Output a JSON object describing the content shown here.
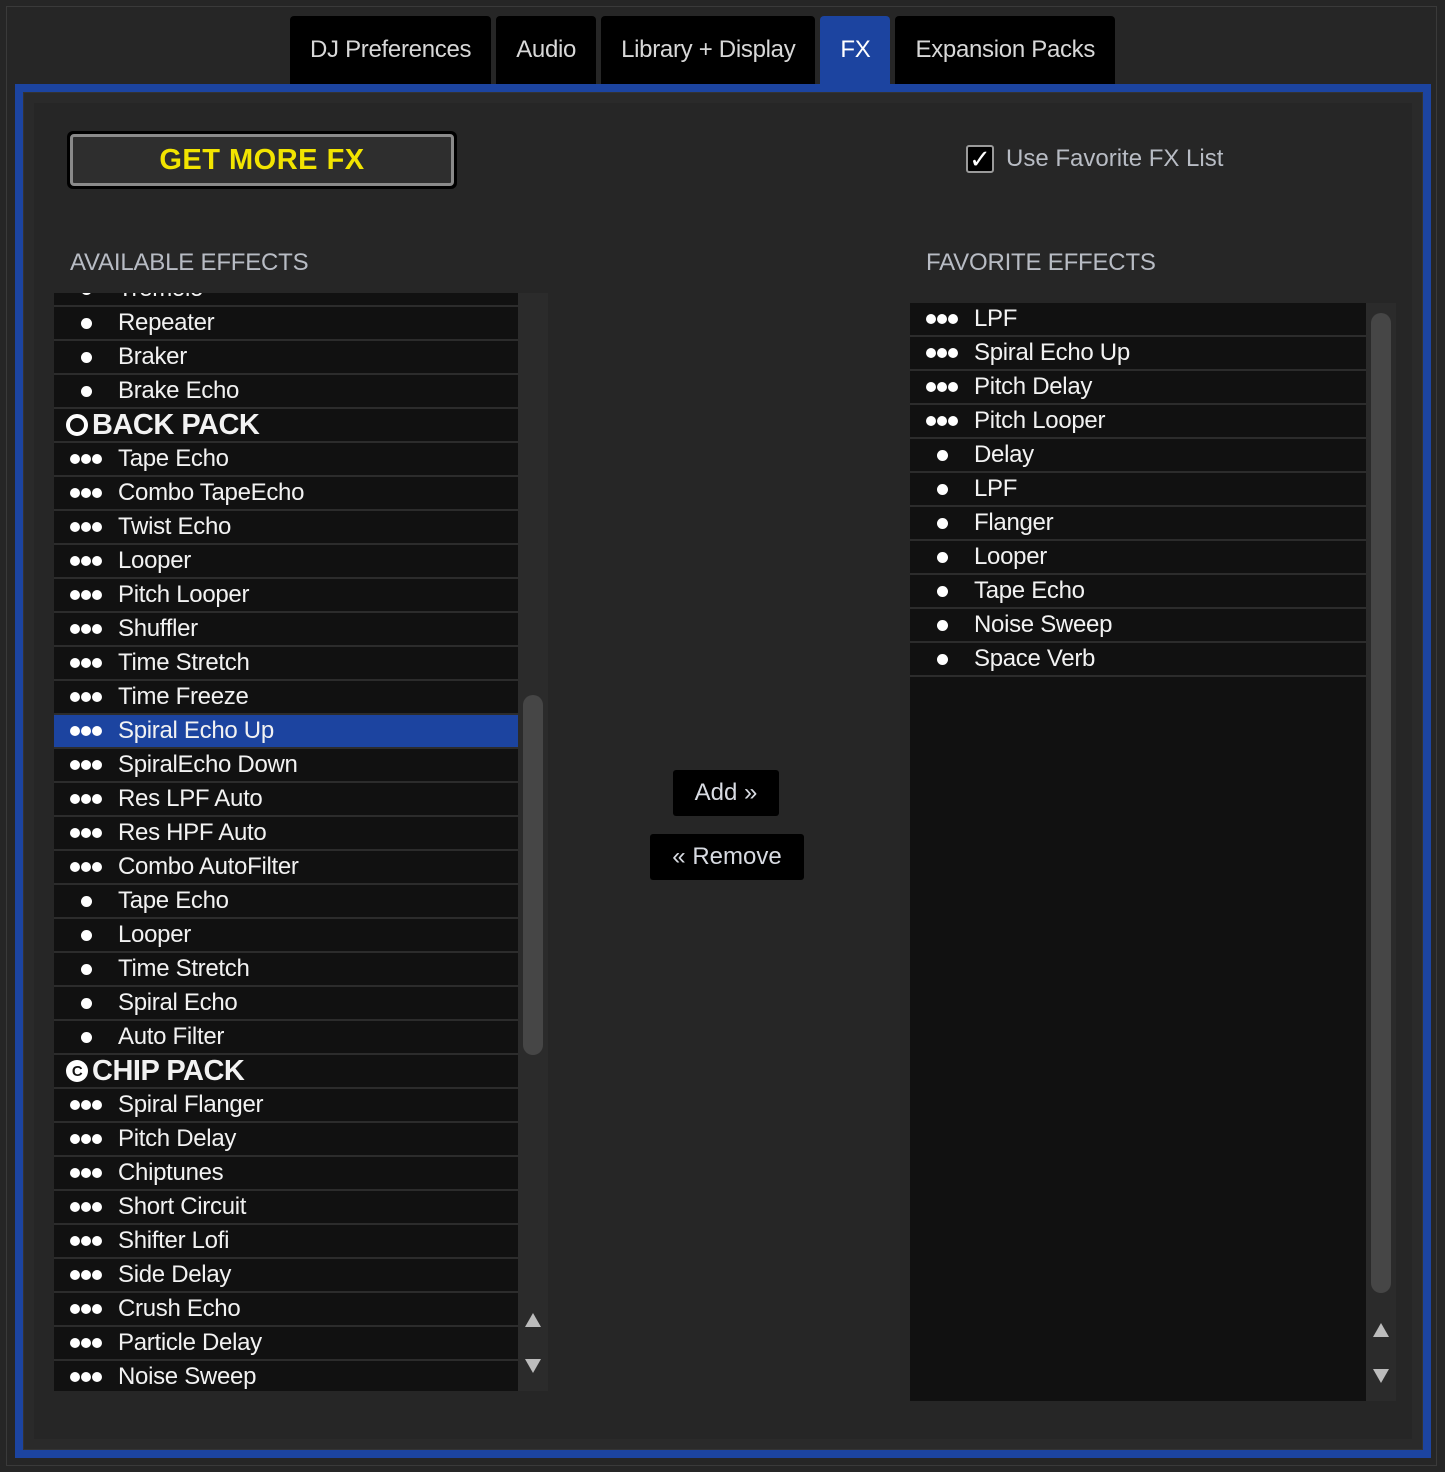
{
  "tabs": [
    {
      "label": "DJ Preferences",
      "active": false
    },
    {
      "label": "Audio",
      "active": false
    },
    {
      "label": "Library + Display",
      "active": false
    },
    {
      "label": "FX",
      "active": true
    },
    {
      "label": "Expansion Packs",
      "active": false
    }
  ],
  "get_more_fx_label": "GET MORE FX",
  "favorite_toggle": {
    "label": "Use Favorite FX List",
    "checked": true,
    "check_glyph": "✓"
  },
  "available": {
    "title": "AVAILABLE EFFECTS",
    "items": [
      {
        "type": "single",
        "label": "Tremolo"
      },
      {
        "type": "single",
        "label": "Repeater"
      },
      {
        "type": "single",
        "label": "Braker"
      },
      {
        "type": "single",
        "label": "Brake Echo"
      },
      {
        "type": "pack",
        "label": "BACK PACK",
        "icon": "back-pack-icon",
        "glyph": ""
      },
      {
        "type": "triple",
        "label": "Tape Echo"
      },
      {
        "type": "triple",
        "label": "Combo TapeEcho"
      },
      {
        "type": "triple",
        "label": "Twist Echo"
      },
      {
        "type": "triple",
        "label": "Looper"
      },
      {
        "type": "triple",
        "label": "Pitch Looper"
      },
      {
        "type": "triple",
        "label": "Shuffler"
      },
      {
        "type": "triple",
        "label": "Time Stretch"
      },
      {
        "type": "triple",
        "label": "Time Freeze"
      },
      {
        "type": "triple",
        "label": "Spiral Echo Up",
        "selected": true
      },
      {
        "type": "triple",
        "label": "SpiralEcho Down"
      },
      {
        "type": "triple",
        "label": "Res LPF Auto"
      },
      {
        "type": "triple",
        "label": "Res HPF Auto"
      },
      {
        "type": "triple",
        "label": "Combo AutoFilter"
      },
      {
        "type": "single",
        "label": "Tape Echo"
      },
      {
        "type": "single",
        "label": "Looper"
      },
      {
        "type": "single",
        "label": "Time Stretch"
      },
      {
        "type": "single",
        "label": "Spiral Echo"
      },
      {
        "type": "single",
        "label": "Auto Filter"
      },
      {
        "type": "pack",
        "label": "CHIP PACK",
        "icon": "chip-pack-icon",
        "glyph": "C"
      },
      {
        "type": "triple",
        "label": "Spiral Flanger"
      },
      {
        "type": "triple",
        "label": "Pitch Delay"
      },
      {
        "type": "triple",
        "label": "Chiptunes"
      },
      {
        "type": "triple",
        "label": "Short Circuit"
      },
      {
        "type": "triple",
        "label": "Shifter Lofi"
      },
      {
        "type": "triple",
        "label": "Side Delay"
      },
      {
        "type": "triple",
        "label": "Crush Echo"
      },
      {
        "type": "triple",
        "label": "Particle Delay"
      },
      {
        "type": "triple",
        "label": "Noise Sweep"
      }
    ]
  },
  "favorites": {
    "title": "FAVORITE EFFECTS",
    "items": [
      {
        "type": "triple",
        "label": "LPF"
      },
      {
        "type": "triple",
        "label": "Spiral Echo Up"
      },
      {
        "type": "triple",
        "label": "Pitch Delay"
      },
      {
        "type": "triple",
        "label": "Pitch Looper"
      },
      {
        "type": "single",
        "label": "Delay"
      },
      {
        "type": "single",
        "label": "LPF"
      },
      {
        "type": "single",
        "label": "Flanger"
      },
      {
        "type": "single",
        "label": "Looper"
      },
      {
        "type": "single",
        "label": "Tape Echo"
      },
      {
        "type": "single",
        "label": "Noise Sweep"
      },
      {
        "type": "single",
        "label": "Space Verb"
      }
    ]
  },
  "buttons": {
    "add": "Add »",
    "remove": "« Remove"
  },
  "colors": {
    "accent": "#1c44a0",
    "get_more_text": "#f2e400",
    "background": "#262626",
    "list_bg": "#111111"
  }
}
